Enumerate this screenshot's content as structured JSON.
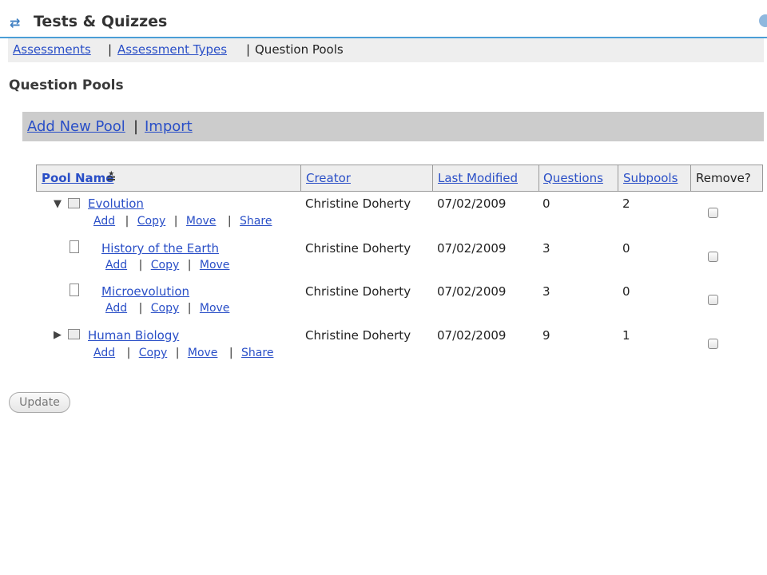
{
  "header": {
    "title": "Tests & Quizzes",
    "icon": "refresh-icon",
    "help_icon": "help-icon"
  },
  "nav": {
    "assessments": "Assessments",
    "sep1": "|",
    "assessment_types": "Assessment Types",
    "sep2": "|",
    "question_pools": "Question Pools"
  },
  "page_title": "Question Pools",
  "actions": {
    "add_new_pool": "Add New Pool",
    "sep": "|",
    "import": "Import"
  },
  "table": {
    "headers": {
      "pool_name": "Pool Name",
      "sort_icon": "≛",
      "creator": "Creator",
      "last_modified": "Last Modified",
      "questions": "Questions",
      "subpools": "Subpools",
      "remove": "Remove?"
    },
    "rows": [
      {
        "name": "Evolution",
        "creator": "Christine Doherty",
        "modified": "07/02/2009",
        "questions": "0",
        "subpools": "2",
        "actions": [
          "Add",
          "Copy",
          "Move",
          "Share"
        ],
        "toggle": "▼",
        "icon": "folder-icon"
      },
      {
        "name": "History of the Earth",
        "creator": "Christine Doherty",
        "modified": "07/02/2009",
        "questions": "3",
        "subpools": "0",
        "actions": [
          "Add",
          "Copy",
          "Move"
        ],
        "icon": "file-icon"
      },
      {
        "name": "Microevolution",
        "creator": "Christine Doherty",
        "modified": "07/02/2009",
        "questions": "3",
        "subpools": "0",
        "actions": [
          "Add",
          "Copy",
          "Move"
        ],
        "icon": "file-icon"
      },
      {
        "name": "Human Biology",
        "creator": "Christine Doherty",
        "modified": "07/02/2009",
        "questions": "9",
        "subpools": "1",
        "actions": [
          "Add",
          "Copy",
          "Move",
          "Share"
        ],
        "toggle": "▶",
        "icon": "folder-icon"
      }
    ],
    "action_sep": "|"
  },
  "update_button": "Update",
  "colors": {
    "link": "#2a4fc7",
    "accent_line": "#4a9ed6",
    "action_bar": "#cccccc",
    "nav_bg": "#eeeeee"
  }
}
